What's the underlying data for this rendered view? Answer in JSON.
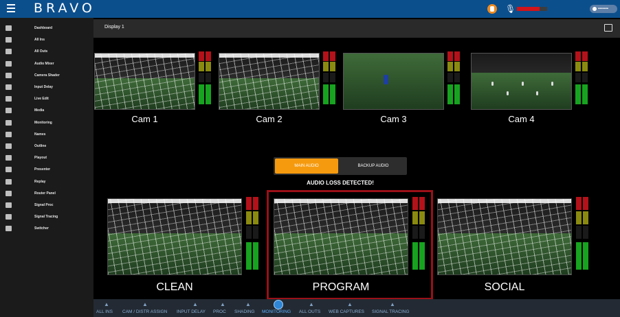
{
  "app": {
    "brand": "BRAVO"
  },
  "topbar": {
    "user_label": "▪▪▪▪▪▪▪",
    "meter_level": 0.75,
    "meter_color": "#d0141a"
  },
  "sidebar": {
    "items": [
      {
        "label": "Dashboard",
        "icon": "grid-icon"
      },
      {
        "label": "All Ins",
        "icon": "input-icon"
      },
      {
        "label": "All Outs",
        "icon": "output-icon"
      },
      {
        "label": "Audio Mixer",
        "icon": "mixer-icon"
      },
      {
        "label": "Camera Shader",
        "icon": "shader-icon"
      },
      {
        "label": "Input Delay",
        "icon": "clock-icon"
      },
      {
        "label": "Live Edit",
        "icon": "edit-icon"
      },
      {
        "label": "Media",
        "icon": "media-icon"
      },
      {
        "label": "Monitoring",
        "icon": "monitor-icon"
      },
      {
        "label": "Names",
        "icon": "names-icon"
      },
      {
        "label": "Outline",
        "icon": "outline-icon"
      },
      {
        "label": "Playout",
        "icon": "playout-icon"
      },
      {
        "label": "Presenter",
        "icon": "presenter-icon"
      },
      {
        "label": "Replay",
        "icon": "replay-icon"
      },
      {
        "label": "Router Panel",
        "icon": "router-icon"
      },
      {
        "label": "Signal Proc",
        "icon": "signal-proc-icon"
      },
      {
        "label": "Signal Tracing",
        "icon": "tracing-icon"
      },
      {
        "label": "Switcher",
        "icon": "switcher-icon"
      }
    ]
  },
  "header": {
    "title": "Display 1"
  },
  "cameras": [
    {
      "label": "Cam 1"
    },
    {
      "label": "Cam 2"
    },
    {
      "label": "Cam 3"
    },
    {
      "label": "Cam 4"
    }
  ],
  "audio": {
    "main_label": "MAIN AUDIO",
    "backup_label": "BACKUP AUDIO",
    "alert": "AUDIO LOSS DETECTED!",
    "accent": "#f59a0e"
  },
  "outputs": [
    {
      "label": "CLEAN"
    },
    {
      "label": "PROGRAM"
    },
    {
      "label": "SOCIAL"
    }
  ],
  "program_highlight_color": "#9b1017",
  "toolbar": {
    "items": [
      {
        "label": "ALL INS"
      },
      {
        "label": "CAM / DISTR ASSIGN"
      },
      {
        "label": "INPUT DELAY"
      },
      {
        "label": "PROC"
      },
      {
        "label": "SHADING"
      },
      {
        "label": "MONITORING"
      },
      {
        "label": "ALL OUTS"
      },
      {
        "label": "WEB CAPTURES"
      },
      {
        "label": "SIGNAL TRACING"
      }
    ]
  }
}
